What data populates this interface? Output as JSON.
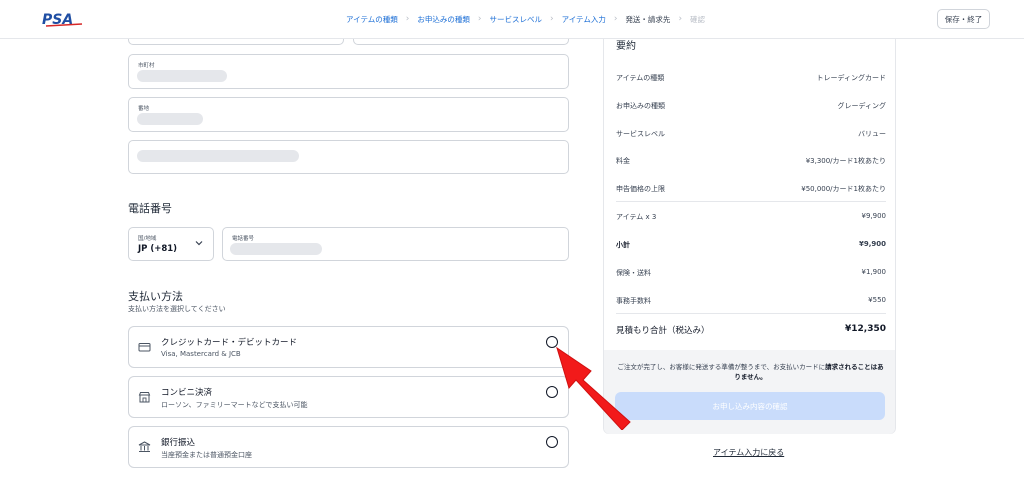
{
  "header": {
    "logo_text": "PSA",
    "steps": [
      {
        "label": "アイテムの種類"
      },
      {
        "label": "お申込みの種類"
      },
      {
        "label": "サービスレベル"
      },
      {
        "label": "アイテム入力"
      },
      {
        "label": "発送・請求先"
      },
      {
        "label": "確認"
      }
    ],
    "save_label": "保存・終了"
  },
  "address": {
    "city_label": "市町村",
    "street_label": "番地"
  },
  "phone": {
    "section_title": "電話番号",
    "country_label": "国/地域",
    "country_value": "JP (+81)",
    "number_label": "電話番号"
  },
  "payment": {
    "section_title": "支払い方法",
    "section_subtitle": "支払い方法を選択してください",
    "options": [
      {
        "title": "クレジットカード・デビットカード",
        "description": "Visa, Mastercard & JCB",
        "icon": "credit-card-icon"
      },
      {
        "title": "コンビニ決済",
        "description": "ローソン、ファミリーマートなどで支払い可能",
        "icon": "store-icon"
      },
      {
        "title": "銀行振込",
        "description": "当座預金または普通預金口座",
        "icon": "bank-icon"
      }
    ]
  },
  "summary": {
    "title": "要約",
    "rows": [
      {
        "label": "アイテムの種類",
        "value": "トレーディングカード"
      },
      {
        "label": "お申込みの種類",
        "value": "グレーディング"
      },
      {
        "label": "サービスレベル",
        "value": "バリュー"
      },
      {
        "label": "料金",
        "value": "¥3,300/カード1枚あたり"
      },
      {
        "label": "申告価格の上限",
        "value": "¥50,000/カード1枚あたり"
      },
      {
        "label": "アイテム x 3",
        "value": "¥9,900"
      },
      {
        "label": "小計",
        "value": "¥9,900"
      },
      {
        "label": "保険・送料",
        "value": "¥1,900"
      },
      {
        "label": "事務手数料",
        "value": "¥550"
      }
    ],
    "total_label": "見積もり合計（税込み）",
    "total_value": "¥12,350",
    "notice_text": "ご注文が完了し、お客様に発送する準備が整うまで、お支払いカードに",
    "notice_bold": "請求されることはありません。",
    "confirm_label": "お申し込み内容の確認",
    "back_label": "アイテム入力に戻る"
  },
  "colors": {
    "accent": "#1d6fd6",
    "logo_blue": "#1f4ea3",
    "logo_red": "#d62828",
    "button_disabled": "#c9dcfb",
    "arrow": "#f21a1a"
  }
}
